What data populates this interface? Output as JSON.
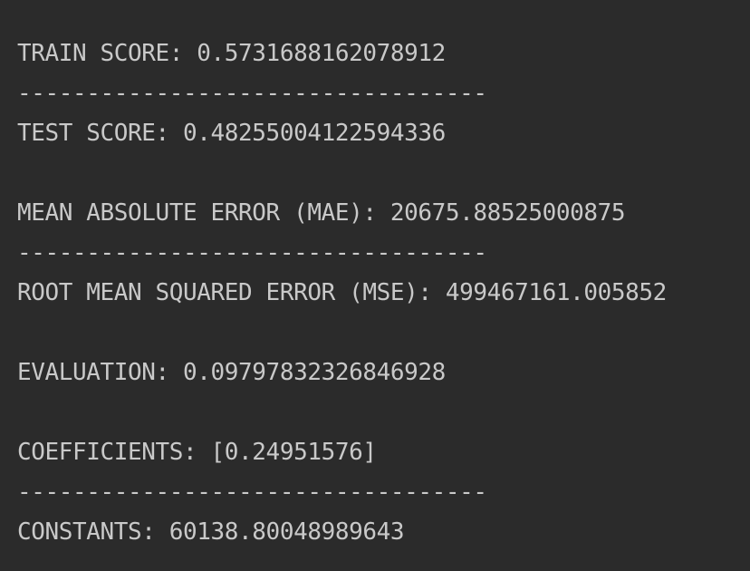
{
  "console": {
    "lines": [
      "TRAIN SCORE: 0.5731688162078912",
      "TEST SCORE: 0.48255004122594336",
      "MEAN ABSOLUTE ERROR (MAE): 20675.88525000875",
      "ROOT MEAN SQUARED ERROR (MSE): 499467161.005852",
      "EVALUATION: 0.09797832326846928",
      "COEFFICIENTS: [0.24951576]",
      "CONSTANTS: 60138.80048989643"
    ],
    "separator": "----------------------------------",
    "colors": {
      "background": "#2b2b2b",
      "text": "#c9c9c9"
    }
  }
}
